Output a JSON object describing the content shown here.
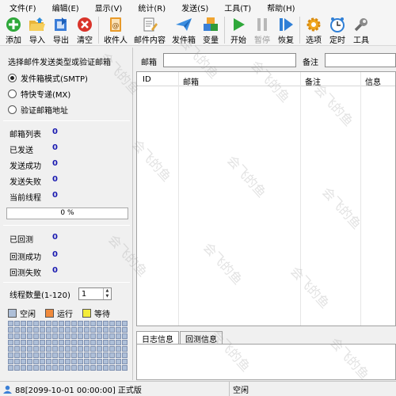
{
  "menu": [
    "文件(F)",
    "编辑(E)",
    "显示(V)",
    "统计(R)",
    "发送(S)",
    "工具(T)",
    "帮助(H)"
  ],
  "toolbar": {
    "add": "添加",
    "import": "导入",
    "export": "导出",
    "clear": "清空",
    "recipient": "收件人",
    "content": "邮件内容",
    "outbox": "发件箱",
    "variable": "变量",
    "start": "开始",
    "pause": "暂停",
    "resume": "恢复",
    "options": "选项",
    "timer": "定时",
    "tools": "工具"
  },
  "send_mode": {
    "title": "选择邮件发送类型或验证邮箱",
    "options": [
      "发件箱模式(SMTP)",
      "特快专递(MX)",
      "验证邮箱地址"
    ],
    "selected_index": 0
  },
  "stats": [
    {
      "label": "邮箱列表",
      "value": "0"
    },
    {
      "label": "已发送",
      "value": "0"
    },
    {
      "label": "发送成功",
      "value": "0"
    },
    {
      "label": "发送失败",
      "value": "0"
    },
    {
      "label": "当前线程",
      "value": "0"
    }
  ],
  "progress": {
    "text": "0 %",
    "percent": 0
  },
  "reply_stats": [
    {
      "label": "已回测",
      "value": "0"
    },
    {
      "label": "回测成功",
      "value": "0"
    },
    {
      "label": "回测失败",
      "value": "0"
    }
  ],
  "threads": {
    "label": "线程数量(1-120)",
    "value": "1"
  },
  "legend": [
    {
      "label": "空闲",
      "color": "#aebfd8"
    },
    {
      "label": "运行",
      "color": "#f08a3c"
    },
    {
      "label": "等待",
      "color": "#f4ec3a"
    }
  ],
  "filter": {
    "email_label": "邮箱",
    "note_label": "备注"
  },
  "table": {
    "columns": [
      "ID",
      "邮箱",
      "备注",
      "信息"
    ]
  },
  "bottom_tabs": [
    "日志信息",
    "回测信息"
  ],
  "status": {
    "left": "88[2099-10-01 00:00:00] 正式版",
    "right": "空闲"
  },
  "watermark": "会飞的鱼"
}
